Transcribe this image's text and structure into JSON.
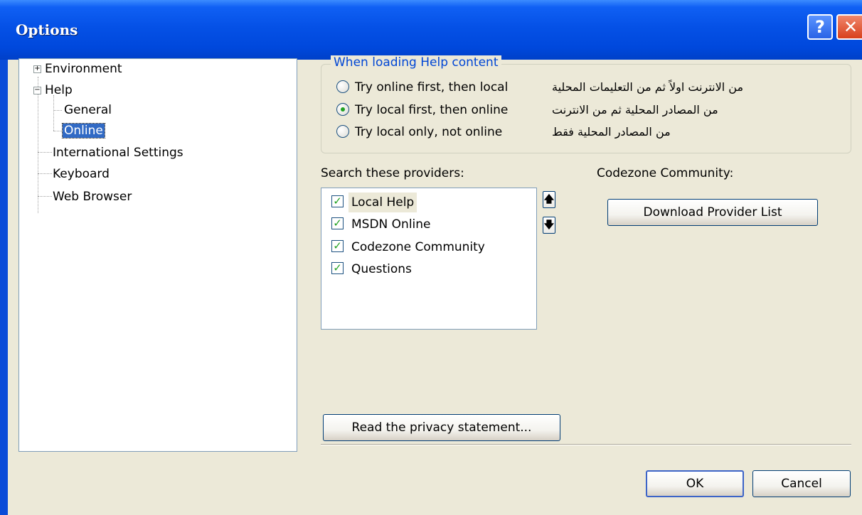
{
  "window": {
    "title": "Options",
    "help_glyph": "?",
    "close_glyph": "✕"
  },
  "tree": {
    "items": [
      {
        "label": "Environment",
        "expander": "+"
      },
      {
        "label": "Help",
        "expander": "−"
      },
      {
        "label": "General"
      },
      {
        "label": "Online",
        "selected": true
      },
      {
        "label": "International Settings"
      },
      {
        "label": "Keyboard"
      },
      {
        "label": "Web Browser"
      }
    ]
  },
  "help_content": {
    "group_title": "When loading Help content",
    "options": [
      {
        "label": "Try online first, then local",
        "checked": false,
        "arabic": "من الانترنت اولاً ثم من التعليمات المحلية"
      },
      {
        "label": "Try local first, then online",
        "checked": true,
        "arabic": "من المصادر المحلية ثم من الانترنت"
      },
      {
        "label": "Try local only, not online",
        "checked": false,
        "arabic": "من المصادر المحلية فقط"
      }
    ]
  },
  "providers": {
    "label": "Search these providers:",
    "items": [
      {
        "label": "Local Help",
        "checked": true
      },
      {
        "label": "MSDN Online",
        "checked": true
      },
      {
        "label": "Codezone Community",
        "checked": true
      },
      {
        "label": "Questions",
        "checked": true
      }
    ],
    "move_up_glyph": "🡅",
    "move_down_glyph": "🡇"
  },
  "codezone": {
    "label": "Codezone Community:",
    "download_button": "Download Provider List"
  },
  "privacy_button": "Read the privacy statement...",
  "footer": {
    "ok": "OK",
    "cancel": "Cancel"
  },
  "colors": {
    "title_bar": "#0a4bd8",
    "dialog_bg": "#ece9d8",
    "selection": "#316ac5",
    "group_title": "#0046d5"
  }
}
